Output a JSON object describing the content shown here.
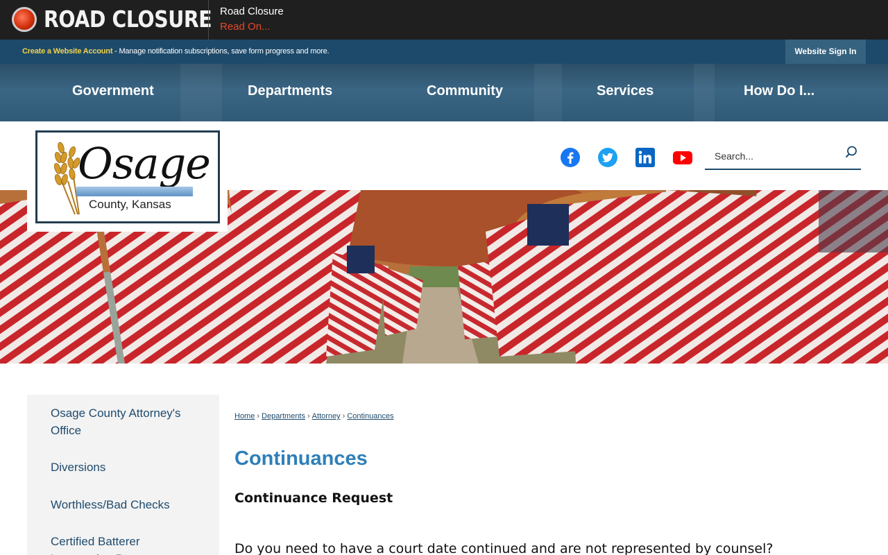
{
  "alert": {
    "title": "ROAD CLOSURE",
    "message": "Road Closure",
    "link_label": "Read On..."
  },
  "account_bar": {
    "create_link": "Create a Website Account",
    "description": " - Manage notification subscriptions, save form progress and more.",
    "signin_label": "Website Sign In"
  },
  "nav": {
    "items": [
      {
        "label": "Government"
      },
      {
        "label": "Departments"
      },
      {
        "label": "Community"
      },
      {
        "label": "Services"
      },
      {
        "label": "How Do I..."
      }
    ]
  },
  "logo": {
    "name": "Osage",
    "subtitle": "County, Kansas"
  },
  "social": {
    "icons": [
      "facebook-icon",
      "twitter-icon",
      "linkedin-icon",
      "youtube-icon"
    ],
    "colors": {
      "facebook": "#1877f2",
      "twitter": "#1da1f2",
      "linkedin": "#0a66c2",
      "youtube": "#ff0000"
    }
  },
  "search": {
    "placeholder": "Search..."
  },
  "sidebar": {
    "items": [
      {
        "label": "Osage County Attorney's Office"
      },
      {
        "label": "Diversions"
      },
      {
        "label": "Worthless/Bad Checks"
      },
      {
        "label": "Certified Batterer Intervention Programs"
      }
    ]
  },
  "breadcrumb": {
    "items": [
      {
        "label": "Home"
      },
      {
        "label": "Departments"
      },
      {
        "label": "Attorney"
      },
      {
        "label": "Continuances"
      }
    ],
    "separator": "›"
  },
  "content": {
    "title": "Continuances",
    "subheading": "Continuance Request",
    "question": "Do you need to have a court date continued and are not represented by counsel?"
  },
  "colors": {
    "brand_dark": "#1d4a6b",
    "title_blue": "#2e7fb8",
    "alert_link": "#e8472b",
    "account_link": "#f2d24b"
  }
}
